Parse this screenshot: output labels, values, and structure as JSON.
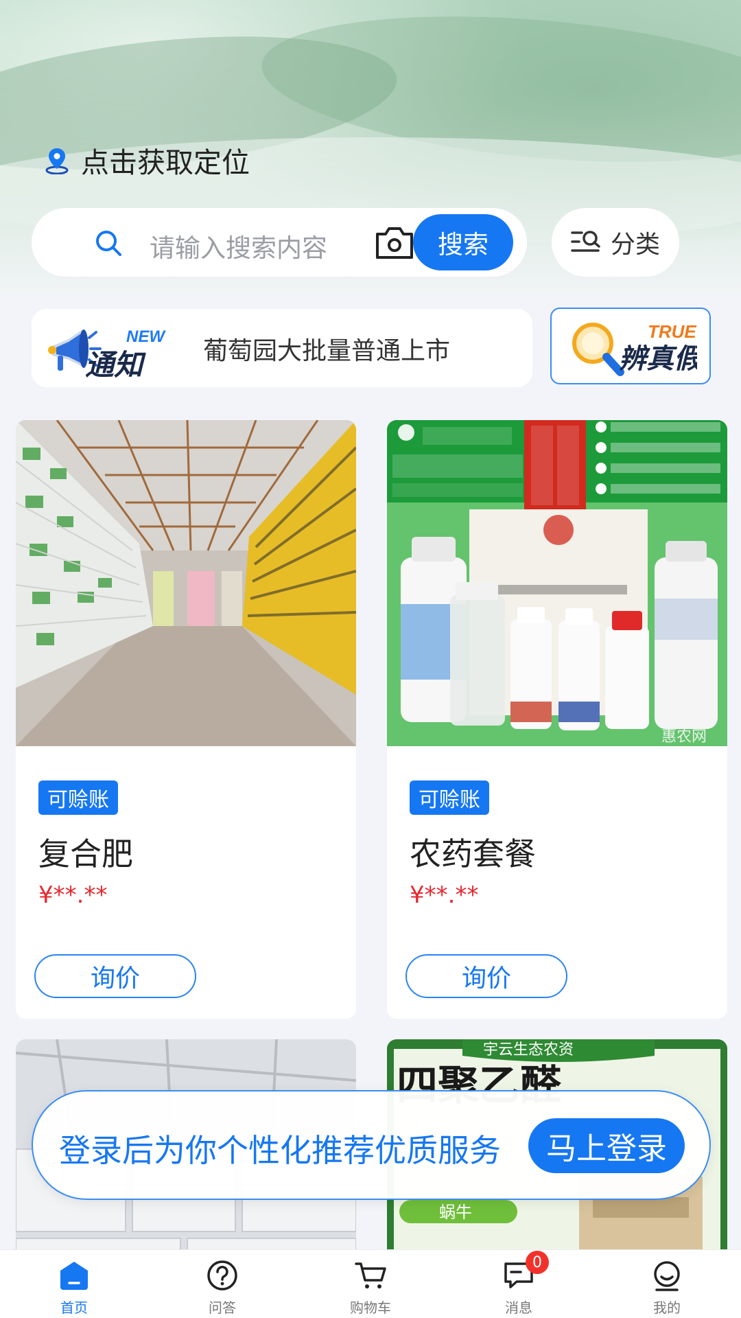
{
  "header": {
    "location_text": "点击获取定位",
    "search": {
      "placeholder": "请输入搜索内容",
      "button_label": "搜索"
    },
    "category_label": "分类"
  },
  "notice": {
    "text": "葡萄园大批量普通上市",
    "badge_icon": "megaphone-new-notice-icon",
    "verify_icon": "magnifier-true-verify-icon"
  },
  "products": [
    {
      "tag": "可赊账",
      "name": "复合肥",
      "price": "¥**.**",
      "button": "询价"
    },
    {
      "tag": "可赊账",
      "name": "农药套餐",
      "price": "¥**.**",
      "button": "询价"
    },
    {
      "name": "",
      "price": ""
    },
    {
      "name": "",
      "price": ""
    }
  ],
  "login_banner": {
    "text": "登录后为你个性化推荐优质服务",
    "button": "马上登录"
  },
  "tabbar": {
    "items": [
      {
        "label": "首页",
        "icon": "home-icon",
        "active": true
      },
      {
        "label": "问答",
        "icon": "question-icon"
      },
      {
        "label": "购物车",
        "icon": "cart-icon"
      },
      {
        "label": "消息",
        "icon": "message-icon",
        "badge": "0"
      },
      {
        "label": "我的",
        "icon": "profile-icon"
      }
    ]
  },
  "colors": {
    "accent": "#1677f2",
    "price": "#e8262d",
    "badge": "#f1322b"
  }
}
